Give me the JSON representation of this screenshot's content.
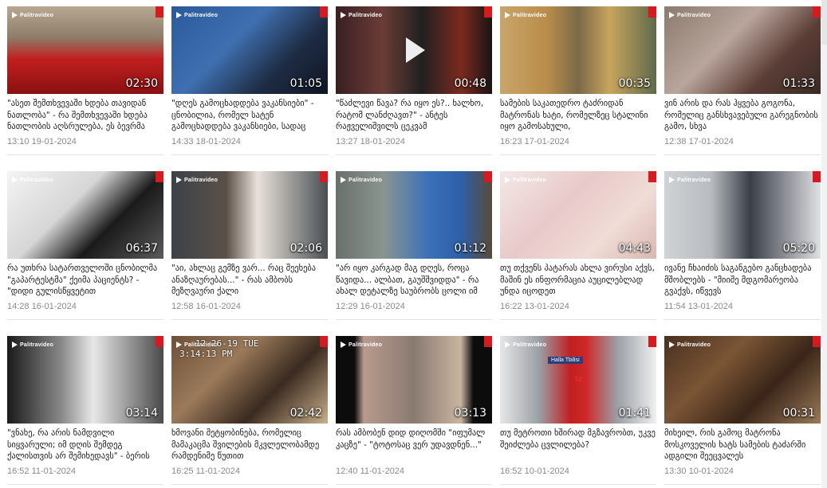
{
  "brand": "Palitravideo",
  "videos": [
    {
      "duration": "02:30",
      "title": "\"ასეთ შემთხვევაში ხდება თავიდან ნათლობა\" - რა შემთხვევაში ხდება ნათლობის აღსრულება, ეს ბევრმა",
      "date": "13:10 19-01-2024"
    },
    {
      "duration": "01:05",
      "title": "\"დღეს გამოცხადდება ვაკანსიები\" - ცნობილია, რომელ სატენ გამოცხადდება ვაკანსიები, სადაც",
      "date": "14:33 18-01-2024"
    },
    {
      "duration": "00:48",
      "title": "\"წაძლევი წავა? რა იყო ეს?.. ხალხო, რატომ ლანძღავთ?\" - ანტეს რაჟველიშვილს ცეკვამ",
      "date": "13:27 18-01-2024"
    },
    {
      "duration": "00:35",
      "title": "სამების საკათედრო ტაძრიდან მატრონას ხატი, რომელზეც სტალინი იყო გამოსახული,",
      "date": "16:23 17-01-2024"
    },
    {
      "duration": "01:33",
      "title": "ვინ არის და რას ჰყვება გოგონა, რომელიც განსხვავებული გარეგნობის გამო, სხვა",
      "date": "12:38 17-01-2024"
    },
    {
      "duration": "06:37",
      "title": "რა უთხრა სატართველოში ცნობილმა \"გაპარტესტმა\" ქეიმა პაციენტს? - \"დიდი გულისწყვეტით",
      "date": "14:28 16-01-2024"
    },
    {
      "duration": "02:06",
      "title": "\"აი, ახლაც გემზე ვარ... რაც შეეხება ანაზღაურებას...\" - რას ამბობს მეზღვაური ქალი",
      "date": "12:58 16-01-2024"
    },
    {
      "duration": "01:12",
      "title": "\"არ იყო კარგად მაგ დღეს, როცა წავიდა... ალბათ, გაუშშვიდდა\" - რა ახალ დეტალზე საუბრობს ცოლი იმ",
      "date": "12:29 16-01-2024"
    },
    {
      "duration": "04:43",
      "title": "თუ თქვენს პატარას ახლა ვირუსი აქვს, მაშინ ეს ინფორმაცია აუცილებლად უნდა იცოდეთ",
      "date": "16:22 13-01-2024"
    },
    {
      "duration": "05:20",
      "title": "ივანე ჩხაიძის საგანგებო განცხადება მშობლებს - \"მიიშე მდგომარეობა გვაქვს, იწვევს",
      "date": "11:54 13-01-2024"
    },
    {
      "duration": "03:14",
      "title": "\"ვნახე, რა არის ნამდვილი სიყვარული; იმ დღის შემდეგ ქალისთვის არ შემიხედავს\" - ბერის",
      "date": "16:52 11-01-2024"
    },
    {
      "duration": "02:42",
      "title": "ხმოვანი შეტყობინება, რომელიც მამაკაცმა შვილების მკვლელობამდე რამდენიმე წუთით",
      "date": "16:25 11-01-2024"
    },
    {
      "duration": "03:13",
      "title": "რას ამბობენ დიდ დიღომში \"იფუმალ კაცზე\" - \"ტოტოსაც ვერ უდავდნენ...\"",
      "date": "12:40 11-01-2024"
    },
    {
      "duration": "01:41",
      "title": "თუ მეტროთი ხშირად მგზავრობთ, უკვე შეიძლება ცვლილება?",
      "date": "16:52 10-01-2024"
    },
    {
      "duration": "00:31",
      "title": "მიხეილ, რის გამოც მატრონა მოსკოველის ხატს სამების ტაძარში ადგილი შეეცვალეს",
      "date": "13:30 10-01-2024"
    }
  ],
  "thumb_overlays": {
    "video_2_stamp_line1": "12-26-19 TUE",
    "video_2_stamp_line2": "3:14:13 PM",
    "video_3_banner": "Halla Tbilisi",
    "video_3_number": "52"
  },
  "colors": {
    "brand_red": "#d71920",
    "date_gray": "#8a8a8a",
    "title_text": "#1a1a1a"
  }
}
